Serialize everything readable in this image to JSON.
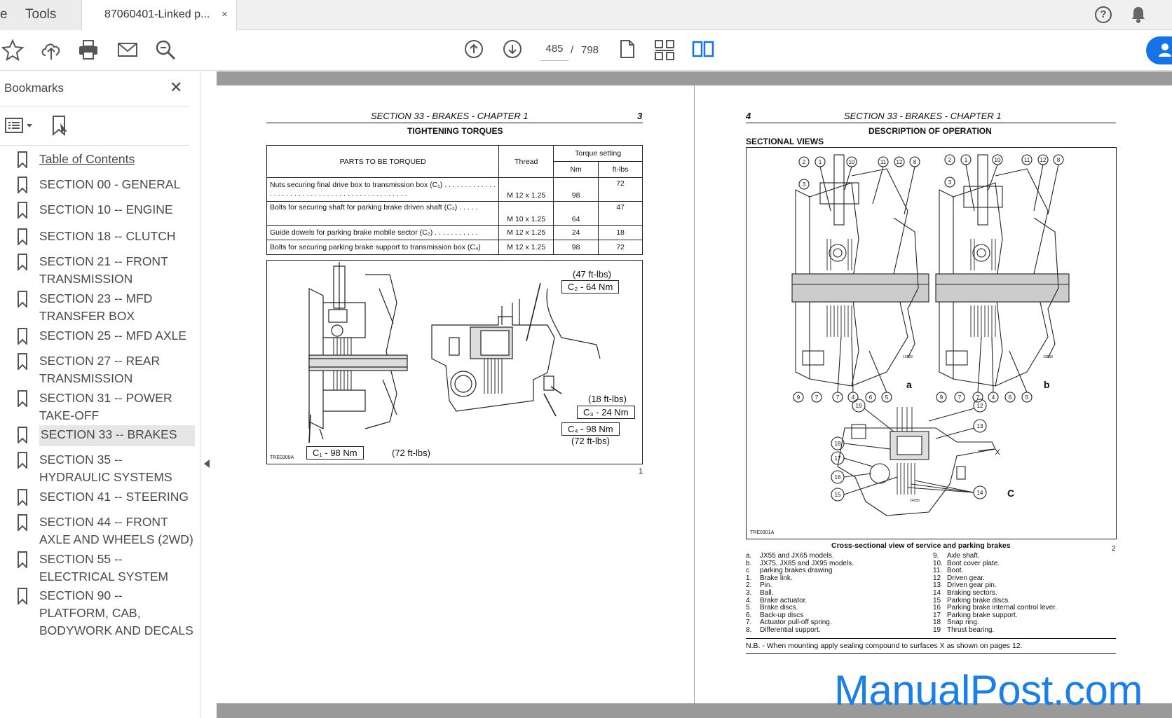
{
  "tabs": {
    "tools": "Tools",
    "document": "87060401-Linked p...",
    "close": "×"
  },
  "toolbar": {
    "current_page": "485",
    "separator": "/",
    "total_pages": "798"
  },
  "sidebar": {
    "title": "Bookmarks",
    "close": "✕",
    "bookmarks": [
      {
        "label": "Table of Contents"
      },
      {
        "label": "SECTION 00 - GENERAL"
      },
      {
        "label": "SECTION 10 -- ENGINE"
      },
      {
        "label": "SECTION 18 -- CLUTCH"
      },
      {
        "label": "SECTION 21 -- FRONT TRANSMISSION"
      },
      {
        "label": "SECTION 23 -- MFD TRANSFER BOX"
      },
      {
        "label": "SECTION 25 -- MFD AXLE"
      },
      {
        "label": "SECTION 27 -- REAR TRANSMISSION"
      },
      {
        "label": "SECTION 31 -- POWER TAKE-OFF"
      },
      {
        "label": "SECTION 33 -- BRAKES"
      },
      {
        "label": "SECTION 35 -- HYDRAULIC SYSTEMS"
      },
      {
        "label": "SECTION 41 -- STEERING"
      },
      {
        "label": "SECTION 44 -- FRONT AXLE AND WHEELS (2WD)"
      },
      {
        "label": "SECTION 55 -- ELECTRICAL SYSTEM"
      },
      {
        "label": "SECTION 90 -- PLATFORM, CAB, BODYWORK AND DECALS"
      }
    ]
  },
  "left_page": {
    "header": "SECTION 33 - BRAKES - CHAPTER 1",
    "page_no": "3",
    "title": "TIGHTENING TORQUES",
    "table": {
      "col_parts": "PARTS TO BE TORQUED",
      "col_thread": "Thread",
      "col_torque": "Torque setting",
      "col_nm": "Nm",
      "col_ftlbs": "ft-lbs",
      "rows": [
        {
          "part": "Nuts securing final drive box to transmission box (C₁) . . . . . . . . . . . . . . . . . . . . . . . . . . . . . . . . . . . . . . . . . . . . . . .",
          "thread": "M 12 x 1.25",
          "nm": "98",
          "ftlbs": "72"
        },
        {
          "part": "Bolts for securing shaft for parking brake driven shaft (C₂) . . . . .",
          "thread": "M 10 x 1.25",
          "nm": "64",
          "ftlbs": "47"
        },
        {
          "part": "Guide dowels for parking brake mobile sector (C₂) . . . . . . . . . . .",
          "thread": "M 12 x 1.25",
          "nm": "24",
          "ftlbs": "18"
        },
        {
          "part": "Bolts for securing parking brake support to transmission box (C₄)",
          "thread": "M 12 x 1.25",
          "nm": "98",
          "ftlbs": "72"
        }
      ]
    },
    "figure": {
      "c2_ft": "(47 ft-lbs)",
      "c2": "C₂ - 64 Nm",
      "c3_ft": "(18 ft-lbs)",
      "c3": "C₃ - 24 Nm",
      "c4": "C₄ - 98 Nm",
      "c4_ft": "(72 ft-lbs)",
      "c1": "C₁ - 98 Nm",
      "c1_ft": "(72 ft-lbs)",
      "code": "TRE0300A",
      "fig_no": "1"
    }
  },
  "right_page": {
    "page_no": "4",
    "header": "SECTION 33 - BRAKES - CHAPTER 1",
    "title": "DESCRIPTION OF OPERATION",
    "subtitle": "SECTIONAL VIEWS",
    "fig_label_a": "a",
    "fig_label_b": "b",
    "fig_label_c": "C",
    "fig_code": "TRE0301A",
    "fig_ref_a": "12559",
    "fig_ref_b": "12560",
    "fig_ref_c": "24255",
    "callouts_top": [
      "2",
      "1",
      "10",
      "11",
      "12",
      "8",
      "3",
      "9",
      "7",
      "7",
      "4",
      "6",
      "5"
    ],
    "callouts_c": [
      "19",
      "12",
      "13",
      "18",
      "17",
      "16",
      "15",
      "14"
    ],
    "callout_x": "X",
    "caption": "Cross-sectional view of service and parking brakes",
    "fig_no": "2",
    "legend_left": [
      {
        "k": "a.",
        "v": "JX55 and JX65 models."
      },
      {
        "k": "b.",
        "v": "JX75, JX85 and JX95 models."
      },
      {
        "k": "c",
        "v": "parking brakes drawing"
      },
      {
        "k": "1.",
        "v": "Brake link."
      },
      {
        "k": "2.",
        "v": "Pin."
      },
      {
        "k": "3.",
        "v": "Ball."
      },
      {
        "k": "4.",
        "v": "Brake actuator."
      },
      {
        "k": "5.",
        "v": "Brake discs."
      },
      {
        "k": "6.",
        "v": "Back-up discs"
      },
      {
        "k": "7.",
        "v": "Actuator pull-off spring."
      },
      {
        "k": "8.",
        "v": "Differential support."
      }
    ],
    "legend_right": [
      {
        "k": "9.",
        "v": "Axle shaft."
      },
      {
        "k": "10.",
        "v": "Boot cover plate."
      },
      {
        "k": "11.",
        "v": "Boot."
      },
      {
        "k": "12",
        "v": "Driven gear."
      },
      {
        "k": "13",
        "v": "Driven gear  pin."
      },
      {
        "k": "14",
        "v": "Braking sectors."
      },
      {
        "k": "15",
        "v": "Parking brake discs."
      },
      {
        "k": "16",
        "v": "Parking brake internal control lever."
      },
      {
        "k": "17",
        "v": "Parking brake support."
      },
      {
        "k": "18",
        "v": "Snap ring."
      },
      {
        "k": "19",
        "v": "Thrust bearing."
      }
    ],
    "note": "N.B. - When mounting apply sealing compound to surfaces X as shown on pages 12."
  },
  "watermark": "ManualPost.com",
  "colors": {
    "accent": "#1473e6",
    "watermark": "#1a7fe6",
    "page_bg": "#9a9a9a"
  }
}
